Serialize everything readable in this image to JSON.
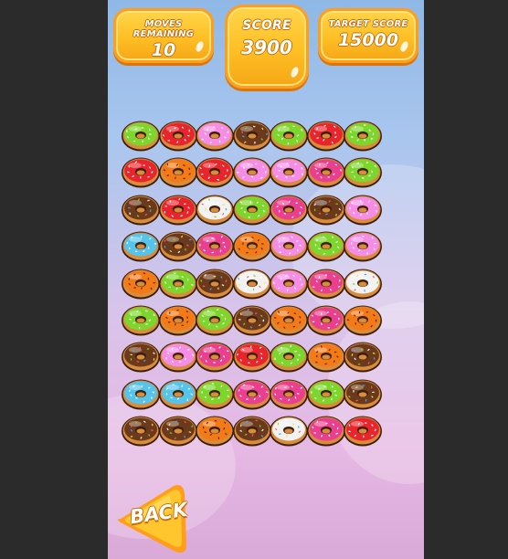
{
  "hud": {
    "moves_label": "MOVES REMAINING",
    "moves_value": "10",
    "score_label": "SCORE",
    "score_value": "3900",
    "target_label": "TARGET SCORE",
    "target_value": "15000"
  },
  "back_button": {
    "label": "BACK"
  },
  "donut_colors": {
    "green": "#7dd62b",
    "red": "#e8242c",
    "pink": "#f58ce6",
    "chocolate": "#6b3a1c",
    "orange": "#f47a17",
    "magenta": "#ea3f8e",
    "white": "#f2f2f2",
    "blue": "#55c3ea"
  },
  "board": [
    [
      "green",
      "red",
      "pink",
      "chocolate",
      "green",
      "red",
      "green"
    ],
    [
      "red",
      "orange",
      "red",
      "pink",
      "pink",
      "magenta",
      "green"
    ],
    [
      "chocolate",
      "red",
      "white",
      "green",
      "magenta",
      "chocolate",
      "pink"
    ],
    [
      "blue",
      "chocolate",
      "magenta",
      "orange",
      "pink",
      "green",
      "pink"
    ],
    [
      "orange",
      "green",
      "chocolate",
      "white",
      "pink",
      "magenta",
      "white"
    ],
    [
      "green",
      "orange",
      "green",
      "chocolate",
      "orange",
      "magenta",
      "orange"
    ],
    [
      "chocolate",
      "pink",
      "magenta",
      "red",
      "green",
      "orange",
      "chocolate"
    ],
    [
      "blue",
      "blue",
      "green",
      "magenta",
      "magenta",
      "green",
      "chocolate"
    ],
    [
      "chocolate",
      "chocolate",
      "orange",
      "chocolate",
      "white",
      "magenta",
      "red"
    ]
  ]
}
